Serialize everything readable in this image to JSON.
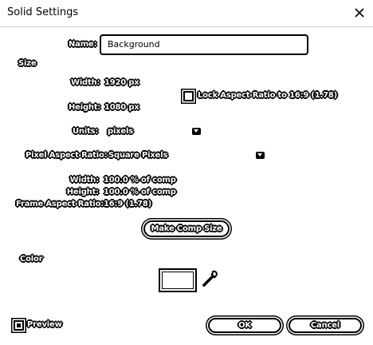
{
  "window": {
    "title": "Solid Settings"
  },
  "name": {
    "label": "Name:",
    "value": "Background"
  },
  "size": {
    "section_label": "Size",
    "width_label": "Width:",
    "width_value": "1920 px",
    "height_label": "Height:",
    "height_value": "1080 px",
    "lock_aspect_label": "Lock Aspect Ratio to 16:9 (1.78)",
    "lock_aspect_checked": false,
    "units_label": "Units:",
    "units_value": "pixels",
    "pixel_aspect_label": "Pixel Aspect Ratio:",
    "pixel_aspect_value": "Square Pixels",
    "pct_width_label": "Width:",
    "pct_width_value": "100.0 % of comp",
    "pct_height_label": "Height:",
    "pct_height_value": "100.0 % of comp",
    "frame_aspect_label": "Frame Aspect Ratio:",
    "frame_aspect_value": "16:9 (1.78)",
    "make_comp_size_label": "Make Comp Size"
  },
  "color": {
    "section_label": "Color",
    "swatch": "#ffffff"
  },
  "footer": {
    "preview_label": "Preview",
    "preview_checked": true,
    "ok_label": "OK",
    "cancel_label": "Cancel"
  },
  "icons": {
    "close": "close-icon",
    "eyedropper": "eyedropper-icon",
    "dropdown": "chevron-down-icon"
  }
}
